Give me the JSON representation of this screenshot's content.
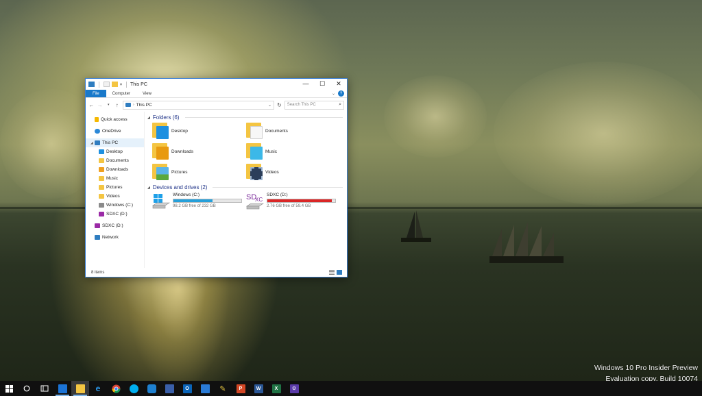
{
  "window": {
    "title": "This PC",
    "controls": {
      "minimize": "—",
      "maximize": "☐",
      "close": "✕"
    },
    "ribbon_tabs": [
      "File",
      "Computer",
      "View"
    ],
    "help": "?",
    "address_path": "This PC",
    "search_placeholder": "Search This PC",
    "status_items": "8 items"
  },
  "nav": {
    "quick_access": "Quick access",
    "onedrive": "OneDrive",
    "this_pc": "This PC",
    "desktop": "Desktop",
    "documents": "Documents",
    "downloads": "Downloads",
    "music": "Music",
    "pictures": "Pictures",
    "videos": "Videos",
    "windows_c": "Windows (C:)",
    "sdxc_d": "SDXC (D:)",
    "sdxc_d_root": "SDXC (D:)",
    "network": "Network"
  },
  "folders": {
    "header": "Folders (6)",
    "items": [
      "Desktop",
      "Documents",
      "Downloads",
      "Music",
      "Pictures",
      "Videos"
    ]
  },
  "drives": {
    "header": "Devices and drives (2)",
    "items": [
      {
        "name": "Windows (C:)",
        "free": "98.2 GB free of 232 GB",
        "used_fraction": 0.58,
        "bar_color": "#26a0da"
      },
      {
        "name": "SDXC (D:)",
        "free": "2.76 GB free of 59.4 GB",
        "used_fraction": 0.95,
        "bar_color": "#da2626"
      }
    ],
    "sd_logo": "SD",
    "sd_logo_sub": "XC"
  },
  "watermark": {
    "line1": "Windows 10 Pro Insider Preview",
    "line2": "Evaluation copy. Build 10074"
  },
  "colors": {
    "accent": "#1979ca",
    "folder": "#f4c542",
    "taskbar": "#101010"
  },
  "taskbar": {
    "icons": [
      "windows-start-icon",
      "search-icon",
      "task-view-icon",
      "store-icon",
      "file-explorer-icon",
      "edge-icon",
      "chrome-icon",
      "skype-icon",
      "headphones-icon",
      "user-icon",
      "outlook-icon",
      "people-icon",
      "pen-icon",
      "powerpoint-icon",
      "word-icon",
      "excel-icon",
      "settings-icon"
    ],
    "letters": {
      "outlook": "O",
      "powerpoint": "P",
      "word": "W",
      "excel": "X"
    }
  }
}
